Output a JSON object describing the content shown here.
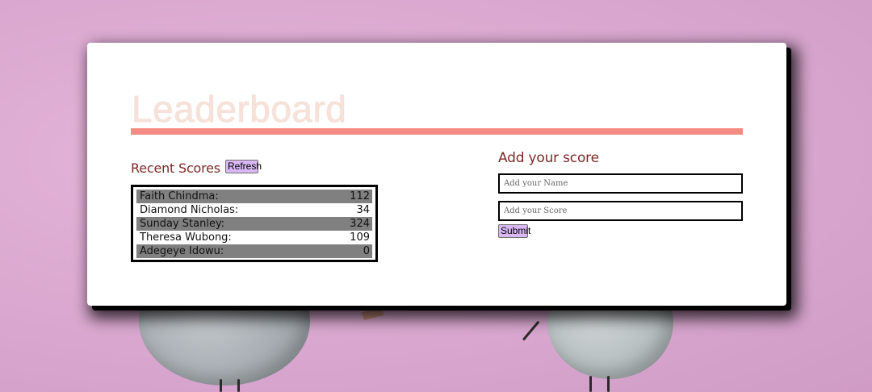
{
  "page": {
    "title": "Leaderboard"
  },
  "recent_scores": {
    "heading": "Recent Scores",
    "refresh_label": "Refresh",
    "entries": [
      {
        "name": "Faith Chindma:",
        "score": "112"
      },
      {
        "name": "Diamond Nicholas:",
        "score": "34"
      },
      {
        "name": "Sunday Stanley:",
        "score": "324"
      },
      {
        "name": "Theresa Wubong:",
        "score": "109"
      },
      {
        "name": "Adegeye Idowu:",
        "score": "0"
      }
    ]
  },
  "add_score": {
    "heading": "Add your score",
    "name_placeholder": "Add your Name",
    "score_placeholder": "Add your Score",
    "submit_label": "Submit"
  },
  "colors": {
    "accent_bar": "#f58b82",
    "button_bg": "#d9b8f5",
    "heading_text": "#7a2a26",
    "stripe_row": "#808080",
    "background": "#dcaad2"
  }
}
